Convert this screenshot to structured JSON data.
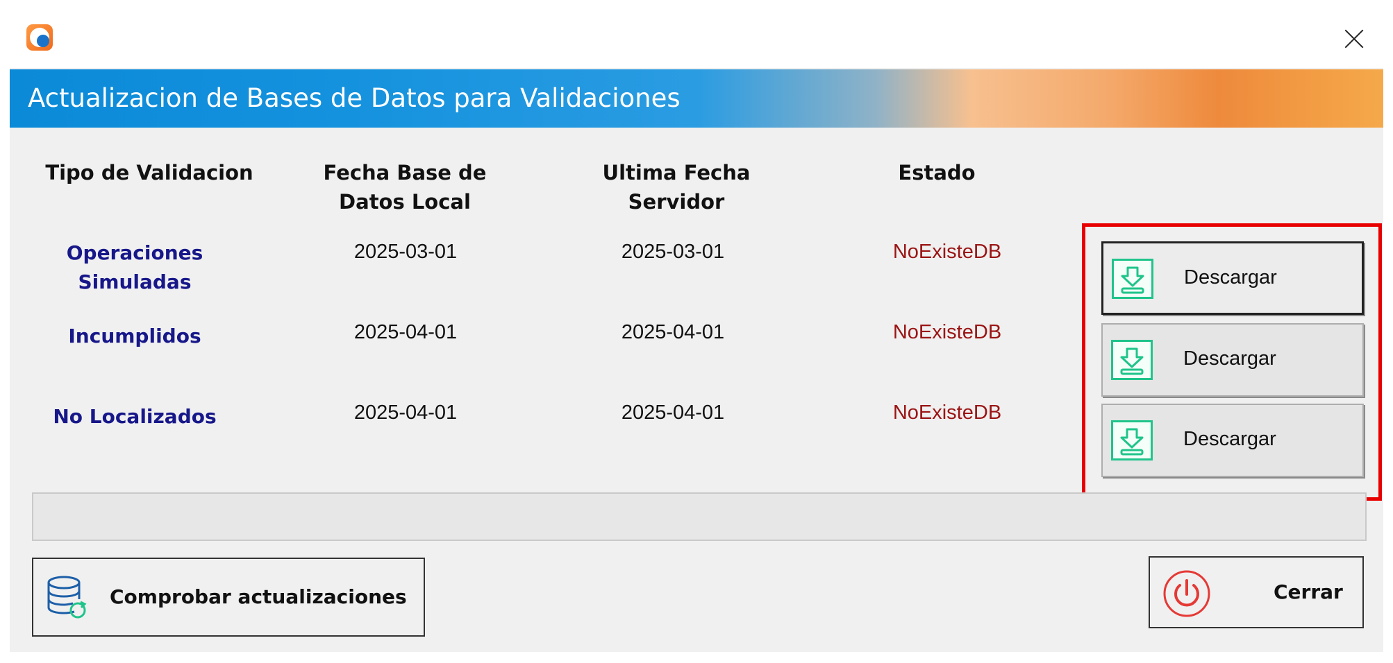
{
  "window": {
    "title_icon": "app-logo-icon",
    "close_icon": "close-icon"
  },
  "header": {
    "title": "Actualizacion de Bases de Datos para Validaciones",
    "gradient_colors": [
      "#0b8ad8",
      "#2a9ce2",
      "#f7c08f",
      "#ee8a3c",
      "#f5a94a"
    ]
  },
  "table": {
    "columns": [
      "Tipo de Validacion",
      "Fecha Base de Datos Local",
      "Ultima Fecha Servidor",
      "Estado"
    ],
    "rows": [
      {
        "tipo": "Operaciones Simuladas",
        "fecha_local": "2025-03-01",
        "ultima_fecha": "2025-03-01",
        "estado": "NoExisteDB",
        "action": "Descargar"
      },
      {
        "tipo": "Incumplidos",
        "fecha_local": "2025-04-01",
        "ultima_fecha": "2025-04-01",
        "estado": "NoExisteDB",
        "action": "Descargar"
      },
      {
        "tipo": "No Localizados",
        "fecha_local": "2025-04-01",
        "ultima_fecha": "2025-04-01",
        "estado": "NoExisteDB",
        "action": "Descargar"
      }
    ],
    "colors": {
      "tipo_label": "#17178a",
      "estado": "#9b1414",
      "highlight": "#e80000",
      "download_icon": "#1fc48a"
    }
  },
  "footer": {
    "check_updates_label": "Comprobar actualizaciones",
    "check_updates_icon": "database-refresh-icon",
    "close_label": "Cerrar",
    "close_icon": "power-icon",
    "power_color": "#e53935"
  }
}
